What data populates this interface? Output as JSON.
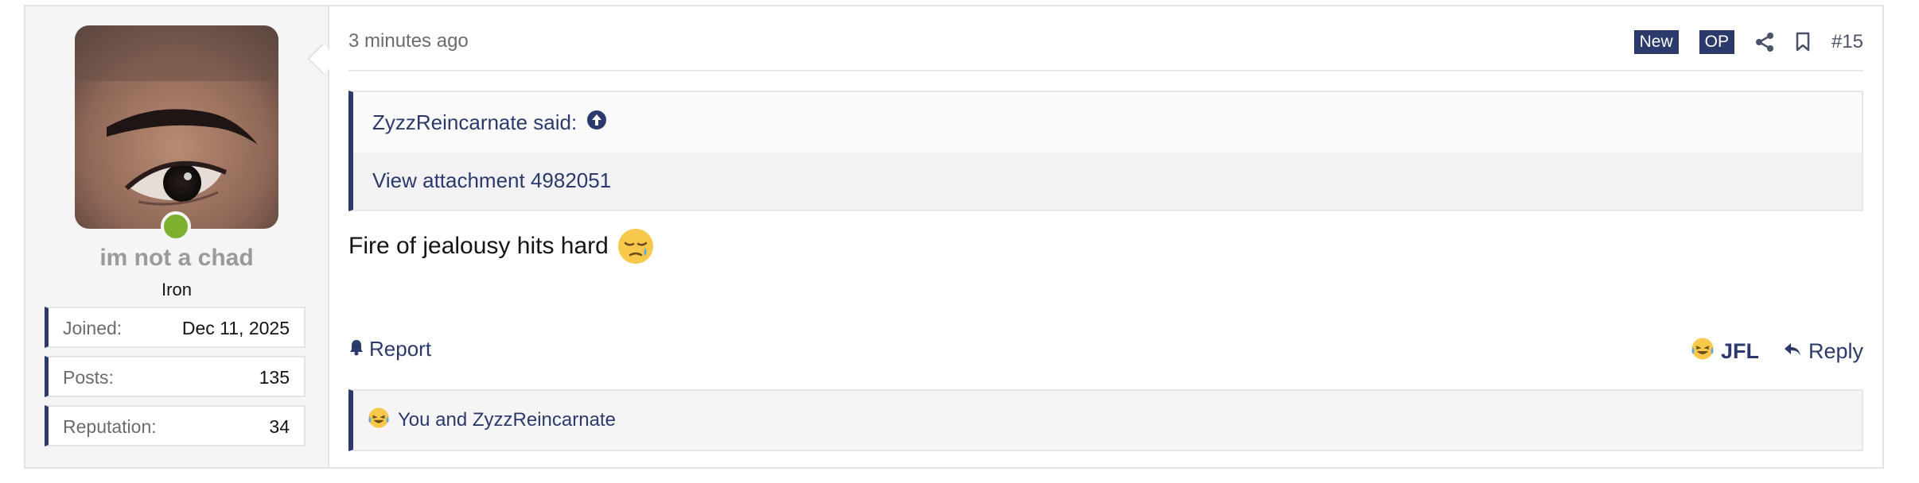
{
  "user": {
    "username": "im not a chad",
    "user_title": "Iron",
    "online_status_color": "#7eb02f",
    "stats": [
      {
        "label": "Joined:",
        "value": "Dec 11, 2025"
      },
      {
        "label": "Posts:",
        "value": "135"
      },
      {
        "label": "Reputation:",
        "value": "34"
      }
    ]
  },
  "post": {
    "time": "3 minutes ago",
    "badges": {
      "new": "New",
      "op": "OP"
    },
    "post_number": "#15",
    "quote": {
      "author_said": "ZyzzReincarnate said:",
      "attachment_link": "View attachment 4982051"
    },
    "message_text": "Fire of jealousy hits hard",
    "message_emoji": "crying-sad-face-emoji",
    "actions": {
      "report": "Report",
      "react": "JFL",
      "reply": "Reply"
    },
    "reactions": {
      "text": "You and ZyzzReincarnate",
      "emoji": "laughing-crying-emoji"
    }
  },
  "colors": {
    "accent": "#2b3a6b",
    "panel_bg": "#f5f5f5",
    "muted_text": "#6b6b6b"
  }
}
